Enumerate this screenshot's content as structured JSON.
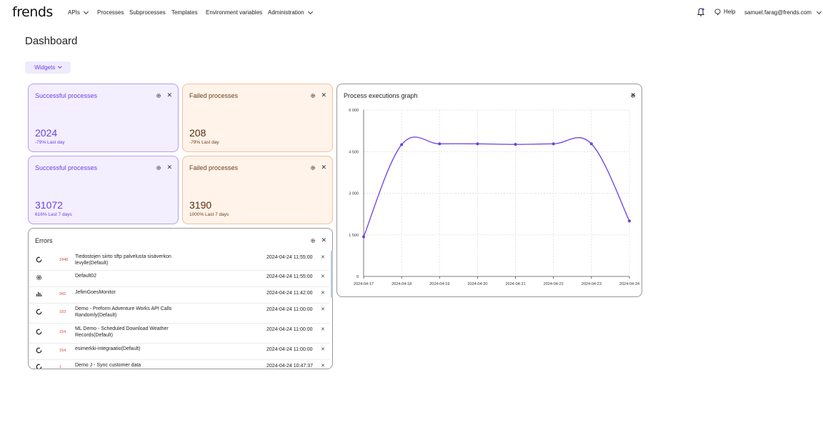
{
  "nav": {
    "logo": "frends",
    "items": [
      {
        "label": "APIs",
        "has_dropdown": true
      },
      {
        "label": "Processes",
        "has_dropdown": false
      },
      {
        "label": "Subprocesses",
        "has_dropdown": false
      },
      {
        "label": "Templates",
        "has_dropdown": false
      },
      {
        "label": "Environment variables",
        "has_dropdown": false
      },
      {
        "label": "Administration",
        "has_dropdown": true
      }
    ],
    "help_label": "Help",
    "user_email": "samuel.farag@frends.com"
  },
  "page_title": "Dashboard",
  "widgets_button": "Widgets",
  "cards": [
    {
      "title": "Successful processes",
      "value": "2024",
      "sub": "-79% Last day",
      "kind": "success"
    },
    {
      "title": "Failed processes",
      "value": "208",
      "sub": "-79% Last day",
      "kind": "fail"
    },
    {
      "title": "Successful processes",
      "value": "31072",
      "sub": "616% Last 7 days",
      "kind": "success"
    },
    {
      "title": "Failed processes",
      "value": "3190",
      "sub": "1000% Last 7 days",
      "kind": "fail"
    }
  ],
  "errors": {
    "title": "Errors",
    "rows": [
      {
        "icon": "spinner-icon",
        "count": "1848",
        "name": "Tiedostojen siirto sftp palvelusta sisäverkon levylle(Default)",
        "time": "2024-04-24 11:55:00"
      },
      {
        "icon": "gear-icon",
        "count": "",
        "name": "Default02",
        "time": "2024-04-24 11:55:00"
      },
      {
        "icon": "bar-chart-icon",
        "count": "942",
        "name": "JefimGoesMonitor",
        "time": "2024-04-24 11:42:00"
      },
      {
        "icon": "spinner-icon",
        "count": "103",
        "name": "Demo - Preform Adventure Works API Calls Randomly(Default)",
        "time": "2024-04-24 11:00:00"
      },
      {
        "icon": "spinner-icon",
        "count": "154",
        "name": "ML Demo - Scheduled Download Weather Records(Default)",
        "time": "2024-04-24 11:00:00"
      },
      {
        "icon": "spinner-icon",
        "count": "154",
        "name": "esimerkki-integraatio(Default)",
        "time": "2024-04-24 11:00:00"
      },
      {
        "icon": "spinner-icon",
        "count": "1",
        "name": "Demo J - Sync customer data",
        "time": "2024-04-24 10:47:37"
      }
    ]
  },
  "graph": {
    "title": "Process executions graph"
  },
  "chart_data": {
    "type": "line",
    "title": "Process executions graph",
    "x": [
      "2024-04-17",
      "2024-04-18",
      "2024-04-19",
      "2024-04-20",
      "2024-04-21",
      "2024-04-22",
      "2024-04-23",
      "2024-04-24"
    ],
    "series": [
      {
        "values": [
          1430,
          4750,
          4780,
          4780,
          4760,
          4780,
          4780,
          2000
        ]
      }
    ],
    "y_ticks": [
      "0",
      "1 500",
      "3 000",
      "4 500",
      "6 000"
    ],
    "ylim": [
      0,
      6000
    ],
    "grid": true,
    "color": "#6a3fe6"
  }
}
